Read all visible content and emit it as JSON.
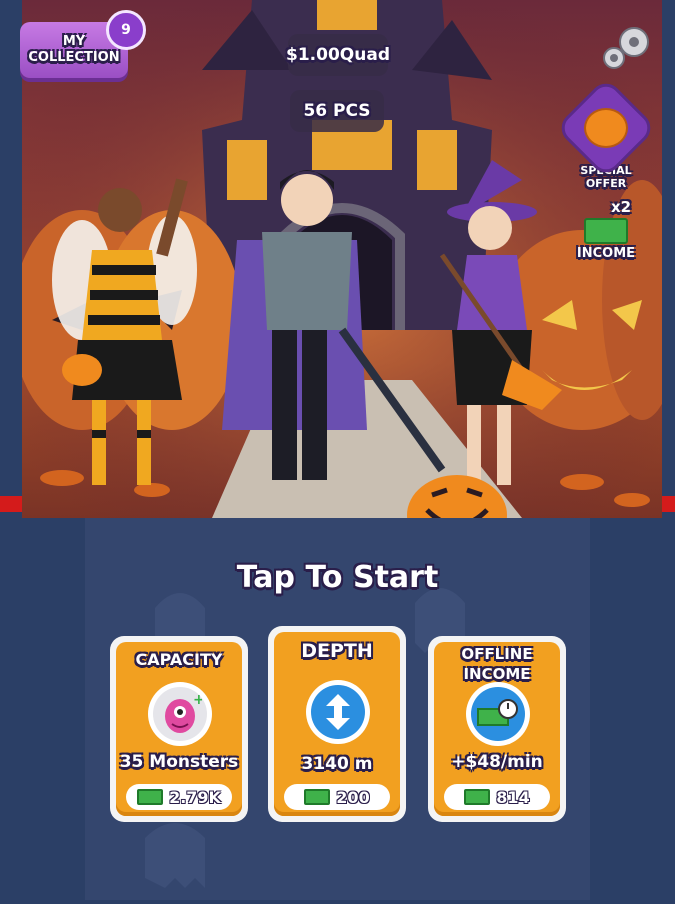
{
  "header": {
    "collection_label_1": "MY",
    "collection_label_2": "COLLECTION",
    "collection_count": "9",
    "money": "$1.00Quad",
    "pieces": "56 PCS"
  },
  "side": {
    "special_offer_1": "SPECIAL",
    "special_offer_2": "OFFER",
    "income_multiplier": "x2",
    "income_label": "INCOME"
  },
  "tap_to_start": "Tap To Start",
  "upgrades": [
    {
      "title_1": "CAPACITY",
      "title_2": "",
      "value": "35 Monsters",
      "cost": "2.79K",
      "icon": "monster-icon"
    },
    {
      "title_1": "DEPTH",
      "title_2": "",
      "value": "3140 m",
      "cost": "200",
      "icon": "vertical-arrows-icon"
    },
    {
      "title_1": "OFFLINE",
      "title_2": "INCOME",
      "value": "+$48/min",
      "cost": "814",
      "icon": "cash-stopwatch-icon"
    }
  ],
  "colors": {
    "card_orange": "#f2a020",
    "collection_purple": "#b565d8",
    "background_navy": "#2b3f66"
  }
}
